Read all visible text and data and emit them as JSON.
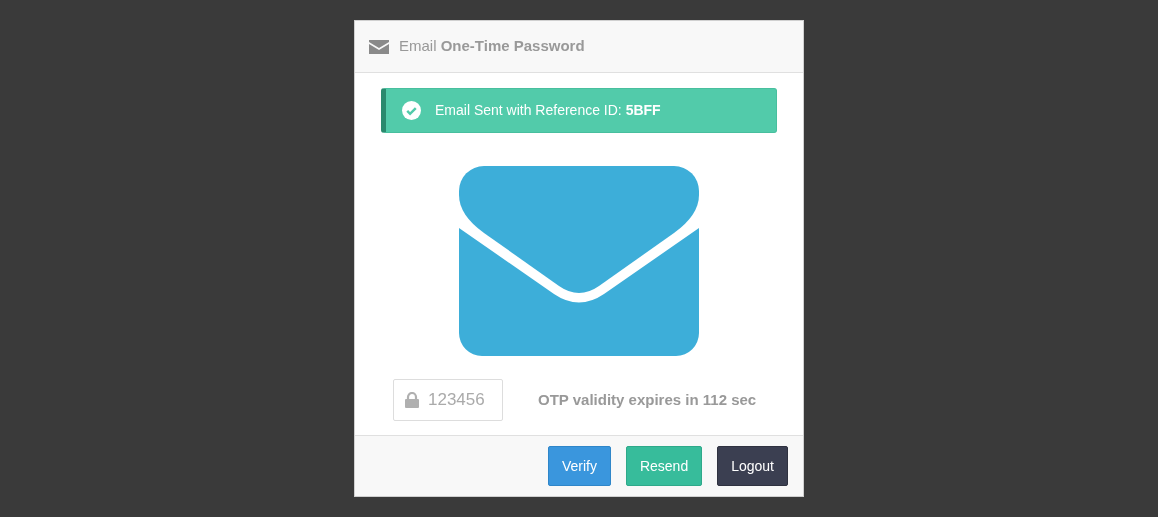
{
  "dialog": {
    "title": "Email **One-Time Password**",
    "alert": {
      "kind": "success",
      "text": "Email Sent with Reference ID: **5BFF**"
    },
    "otp_field": {
      "placeholder": "123456"
    },
    "expiry_text": "OTP validity expires in 112 sec",
    "buttons": [
      {
        "label": "Verify",
        "kind": "primary"
      },
      {
        "label": "Resend",
        "kind": "success"
      },
      {
        "label": "Logout",
        "kind": "dark"
      }
    ]
  }
}
